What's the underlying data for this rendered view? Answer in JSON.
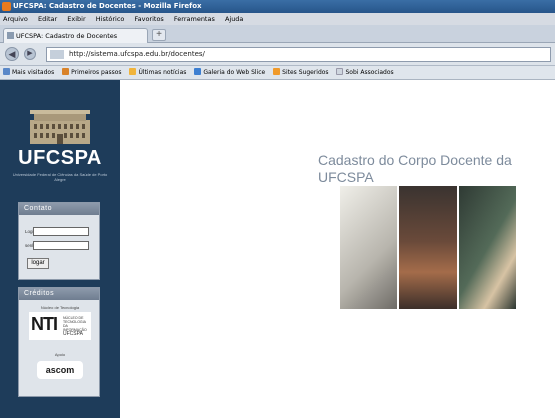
{
  "window": {
    "title": "UFCSPA: Cadastro de Docentes - Mozilla Firefox"
  },
  "menu": [
    "Arquivo",
    "Editar",
    "Exibir",
    "Histórico",
    "Favoritos",
    "Ferramentas",
    "Ajuda"
  ],
  "tab": {
    "label": "UFCSPA: Cadastro de Docentes",
    "new_tab": "+"
  },
  "nav": {
    "back": "◀",
    "forward": "▶",
    "url": "http://sistema.ufcspa.edu.br/docentes/"
  },
  "bookmarks": [
    {
      "label": "Mais visitados",
      "color": "#5a88c8"
    },
    {
      "label": "Primeiros passos",
      "color": "#d9832a"
    },
    {
      "label": "Últimas notícias",
      "color": "#f0b43c"
    },
    {
      "label": "Galeria do Web Slice",
      "color": "#3d7fd1"
    },
    {
      "label": "Sites Sugeridos",
      "color": "#f09a2a"
    },
    {
      "label": "Sobi Associados",
      "color": "#cfd6df"
    }
  ],
  "sidebar": {
    "logo": "UFCSPA",
    "logo_subtitle": "Universidade Federal de Ciências da Saúde de Porto Alegre",
    "login_panel": {
      "title": "Contato",
      "login_label": "Login",
      "password_label": "senha",
      "button": "logar"
    },
    "credits_panel": {
      "title": "Créditos",
      "dev_label": "Núcleo de Tecnologia",
      "nti_big": "NTI",
      "nti_small": "NÚCLEO DE TECNOLOGIA DA INFORMAÇÃO",
      "nti_uf": "UFCSPA",
      "support_label": "Apoio",
      "ascom": "ascom"
    }
  },
  "main": {
    "title": "Cadastro do Corpo Docente da UFCSPA"
  },
  "colors": {
    "sidebar_bg": "#1e3c5a",
    "title_text": "#7d8b9c"
  }
}
